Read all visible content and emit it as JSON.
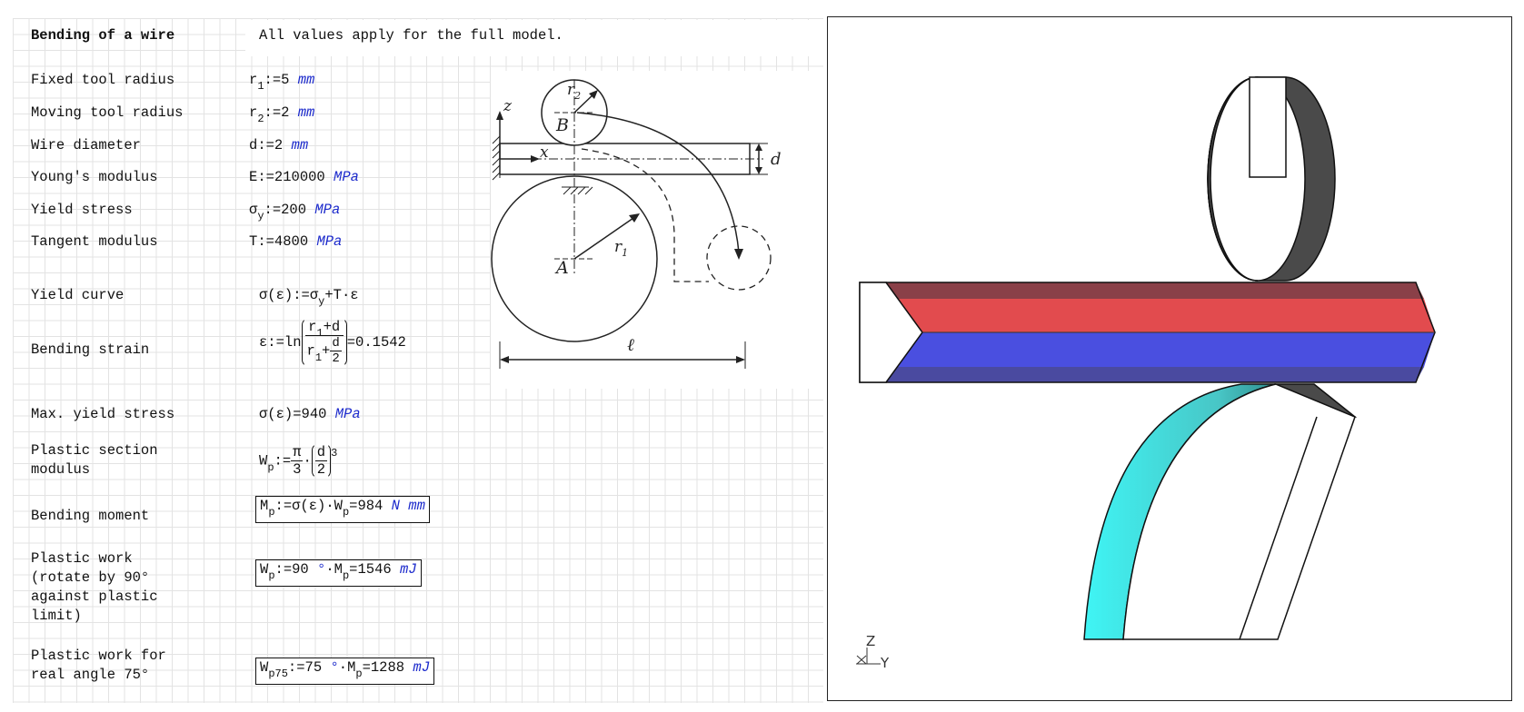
{
  "header": {
    "title": "Bending of a wire",
    "note": "All values apply for the full model."
  },
  "params": {
    "fixed_tool_radius": {
      "label": "Fixed tool radius",
      "sym": "r",
      "sub": "1",
      "op": ":=",
      "value": "5",
      "unit": "mm"
    },
    "moving_tool_radius": {
      "label": "Moving tool radius",
      "sym": "r",
      "sub": "2",
      "op": ":=",
      "value": "2",
      "unit": "mm"
    },
    "wire_diameter": {
      "label": "Wire diameter",
      "sym": "d",
      "op": ":=",
      "value": "2",
      "unit": "mm"
    },
    "youngs_modulus": {
      "label": "Young's modulus",
      "sym": "E",
      "op": ":=",
      "value": "210000",
      "unit": "MPa"
    },
    "yield_stress": {
      "label": "Yield stress",
      "sym": "σ",
      "sub": "y",
      "op": ":=",
      "value": "200",
      "unit": "MPa"
    },
    "tangent_modulus": {
      "label": "Tangent modulus",
      "sym": "T",
      "op": ":=",
      "value": "4800",
      "unit": "MPa"
    }
  },
  "formulas": {
    "yield_curve": {
      "label": "Yield curve",
      "lhs": "σ(ε)",
      "op": ":=",
      "rhs_a": "σ",
      "rhs_sub": "y",
      "rhs_b": "+T·ε"
    },
    "bending_strain": {
      "label": "Bending strain",
      "lhs": "ε:=ln",
      "num_a": "r",
      "num_sub": "1",
      "num_b": "+d",
      "den_a": "r",
      "den_sub": "1",
      "den_b": "+",
      "den_frac_num": "d",
      "den_frac_den": "2",
      "result": "=0.1542"
    },
    "max_yield_stress": {
      "label": "Max. yield stress",
      "lhs": "σ(ε)",
      "result": "=940",
      "unit": "MPa"
    },
    "plastic_section_modulus": {
      "label1": "Plastic section",
      "label2": "modulus",
      "lhs": "W",
      "lhs_sub": "p",
      "op": ":=",
      "pi_num": "π",
      "pi_den": "3",
      "dot": "·",
      "d_num": "d",
      "d_den": "2",
      "exp": "3"
    },
    "bending_moment": {
      "label": "Bending moment",
      "lhs": "M",
      "lhs_sub": "p",
      "op": ":=σ(ε)·W",
      "op_sub": "p",
      "result": "=984",
      "unit": "N mm"
    },
    "plastic_work": {
      "label1": "Plastic work",
      "label2": "(rotate by 90°",
      "label3": "against plastic",
      "label4": "limit)",
      "lhs": "W",
      "lhs_sub": "p",
      "op": ":=90",
      "deg": "°",
      "mid": "·M",
      "mid_sub": "p",
      "result": "=1546",
      "unit": "mJ"
    },
    "plastic_work_real": {
      "label1": "Plastic work for",
      "label2": "real angle 75°",
      "lhs": "W",
      "lhs_sub": "p75",
      "op": ":=75",
      "deg": "°",
      "mid": "·M",
      "mid_sub": "p",
      "result": "=1288",
      "unit": "mJ"
    }
  },
  "diagram": {
    "label_z": "z",
    "label_x": "x",
    "label_B": "B",
    "label_A": "A",
    "label_r1": "r",
    "label_r1_sub": "1",
    "label_r2": "r",
    "label_r2_sub": "2",
    "label_d": "d",
    "label_l": "ℓ"
  },
  "viewport": {
    "axis_z": "Z",
    "axis_y": "Y",
    "colors": {
      "magenta": "#ff40ff",
      "dark_gray": "#4a4a4a",
      "red": "#e24b4e",
      "blue": "#4a4fe0",
      "cyan": "#3ff5f5"
    }
  }
}
